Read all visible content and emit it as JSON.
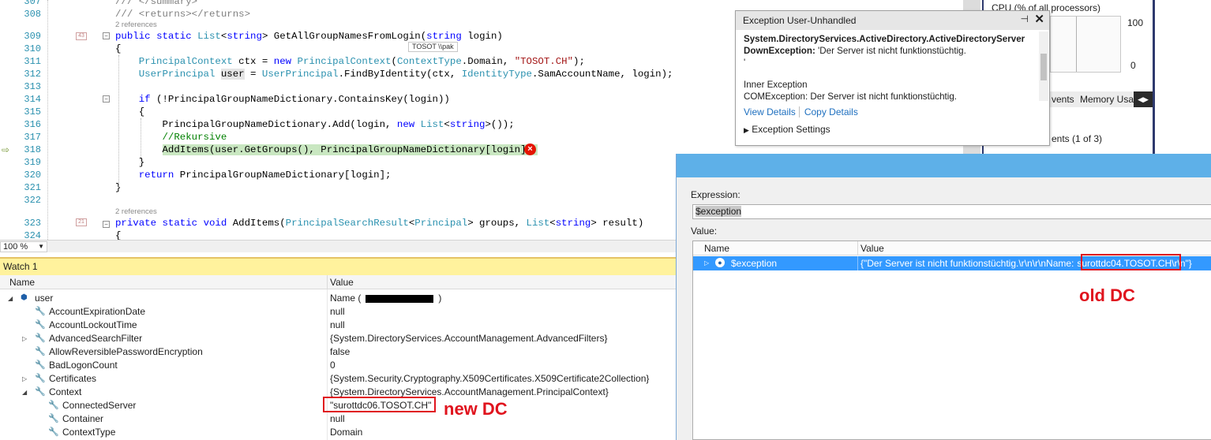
{
  "editor": {
    "lines": [
      {
        "num": "307",
        "html": "<span class=\"gy\">/// &lt;/summary&gt;</span>"
      },
      {
        "num": "308",
        "html": "<span class=\"gy\">/// &lt;returns&gt;&lt;/returns&gt;</span>"
      },
      {
        "num": "309",
        "html": "<span class=\"kw\">public</span> <span class=\"kw\">static</span> <span class=\"ty\">List</span>&lt;<span class=\"kw\">string</span>&gt; GetAllGroupNamesFromLogin(<span class=\"kw\">string</span> login)"
      },
      {
        "num": "310",
        "html": "{"
      },
      {
        "num": "311",
        "html": "    <span class=\"ty\">PrincipalContext</span> ctx = <span class=\"kw\">new</span> <span class=\"ty\">PrincipalContext</span>(<span class=\"ty\">ContextType</span>.Domain, <span class=\"st\">\"TOSOT.CH\"</span>);"
      },
      {
        "num": "312",
        "html": "    <span class=\"ty\">UserPrincipal</span> <span class=\"hl-var\">user</span> = <span class=\"ty\">UserPrincipal</span>.FindByIdentity(ctx, <span class=\"ty\">IdentityType</span>.SamAccountName, login);"
      },
      {
        "num": "313",
        "html": ""
      },
      {
        "num": "314",
        "html": "    <span class=\"kw\">if</span> (!PrincipalGroupNameDictionary.ContainsKey(login))"
      },
      {
        "num": "315",
        "html": "    {"
      },
      {
        "num": "316",
        "html": "        PrincipalGroupNameDictionary.Add(login, <span class=\"kw\">new</span> <span class=\"ty\">List</span>&lt;<span class=\"kw\">string</span>&gt;());"
      },
      {
        "num": "317",
        "html": "        <span class=\"cm\">//Rekursive</span>"
      },
      {
        "num": "318",
        "html": "        <span class=\"hl-line\">AddItems(user.GetGroups(), PrincipalGroupNameDictionary[login]);</span>"
      },
      {
        "num": "319",
        "html": "    }"
      },
      {
        "num": "320",
        "html": "    <span class=\"kw\">return</span> PrincipalGroupNameDictionary[login];"
      },
      {
        "num": "321",
        "html": "}"
      },
      {
        "num": "322",
        "html": ""
      },
      {
        "num": "323",
        "html": "<span class=\"kw\">private</span> <span class=\"kw\">static</span> <span class=\"kw\">void</span> AddItems(<span class=\"ty\">PrincipalSearchResult</span>&lt;<span class=\"ty\">Principal</span>&gt; groups, <span class=\"ty\">List</span>&lt;<span class=\"kw\">string</span>&gt; result)"
      },
      {
        "num": "324",
        "html": "{"
      }
    ],
    "refs_309": "2 references",
    "refs_323": "2 references",
    "badge_309": "43",
    "badge_323": "21",
    "tooltip": "TOSOT \\\\pak",
    "zoom": "100 %"
  },
  "watch": {
    "title": "Watch 1",
    "col_name": "Name",
    "col_value": "Value",
    "user_value_prefix": "Name (",
    "user_value_suffix": ")",
    "rows": [
      {
        "name": "user",
        "value": "",
        "indent": 0,
        "expander": "◢",
        "icon": "object"
      },
      {
        "name": "AccountExpirationDate",
        "value": "null",
        "indent": 1,
        "expander": "",
        "icon": "wrench"
      },
      {
        "name": "AccountLockoutTime",
        "value": "null",
        "indent": 1,
        "expander": "",
        "icon": "wrench"
      },
      {
        "name": "AdvancedSearchFilter",
        "value": "{System.DirectoryServices.AccountManagement.AdvancedFilters}",
        "indent": 1,
        "expander": "▷",
        "icon": "wrench"
      },
      {
        "name": "AllowReversiblePasswordEncryption",
        "value": "false",
        "indent": 1,
        "expander": "",
        "icon": "wrench"
      },
      {
        "name": "BadLogonCount",
        "value": "0",
        "indent": 1,
        "expander": "",
        "icon": "wrench"
      },
      {
        "name": "Certificates",
        "value": "{System.Security.Cryptography.X509Certificates.X509Certificate2Collection}",
        "indent": 1,
        "expander": "▷",
        "icon": "wrench"
      },
      {
        "name": "Context",
        "value": "{System.DirectoryServices.AccountManagement.PrincipalContext}",
        "indent": 1,
        "expander": "◢",
        "icon": "wrench"
      },
      {
        "name": "ConnectedServer",
        "value": "\"surottdc06.TOSOT.CH\"",
        "indent": 2,
        "expander": "",
        "icon": "wrench"
      },
      {
        "name": "Container",
        "value": "null",
        "indent": 2,
        "expander": "",
        "icon": "wrench"
      },
      {
        "name": "ContextType",
        "value": "Domain",
        "indent": 2,
        "expander": "",
        "icon": "wrench"
      }
    ],
    "annotation": "new DC"
  },
  "exception": {
    "title": "Exception User-Unhandled",
    "line1": "System.DirectoryServices.ActiveDirectory.ActiveDirectoryServer",
    "line2_bold": "DownException:",
    "line2_rest": " 'Der Server ist nicht funktionstüchtig.",
    "line3": "'",
    "inner_title": "Inner Exception",
    "inner_text": "COMException: Der Server ist nicht funktionstüchtig.",
    "view_details": "View Details",
    "copy_details": "Copy Details",
    "settings": "Exception Settings"
  },
  "diagnostics": {
    "cpu_label": "CPU (% of all processors)",
    "max": "100",
    "min": "0",
    "tab_events": "vents",
    "tab_memory": "Memory Usa",
    "events_text": "ents (1 of 3)"
  },
  "quickwatch": {
    "expression_label": "Expression:",
    "expression": "$exception",
    "value_label": "Value:",
    "col_name": "Name",
    "col_value": "Value",
    "row_name": "$exception",
    "row_value_prefix": "{\"Der Server ist nicht funktionstüchtig.\\r\\n\\r\\nName:",
    "row_value_server": "surottdc04.TOSOT.CH",
    "row_value_suffix": "\\r\\n\"}",
    "annotation": "old DC"
  },
  "colors": {
    "keyword": "#0000ff",
    "type": "#2b91af",
    "string": "#a31515",
    "comment": "#008000",
    "annotation_red": "#e0141e",
    "watch_title_bg": "#fff29d",
    "selection_blue": "#3399ff"
  }
}
